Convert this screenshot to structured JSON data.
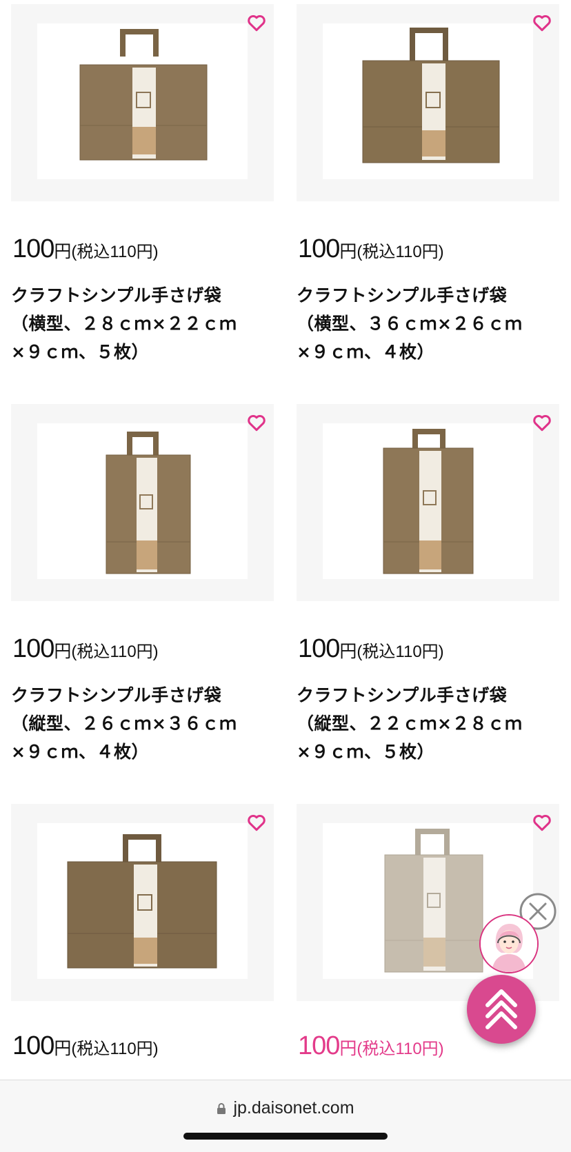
{
  "products": [
    {
      "price": "100",
      "unit": "円",
      "tax": "(税込110円)",
      "title": "クラフトシンプル手さげ袋\n（横型、２８ｃｍ×２２ｃｍ\n×９ｃｍ、５枚）",
      "bag_color": "#8d7657",
      "orientation": "landscape",
      "favorite_icon": "heart-outline-icon"
    },
    {
      "price": "100",
      "unit": "円",
      "tax": "(税込110円)",
      "title": "クラフトシンプル手さげ袋\n（横型、３６ｃｍ×２６ｃｍ\n×９ｃｍ、４枚）",
      "bag_color": "#86704f",
      "orientation": "landscape",
      "favorite_icon": "heart-outline-icon"
    },
    {
      "price": "100",
      "unit": "円",
      "tax": "(税込110円)",
      "title": "クラフトシンプル手さげ袋\n（縦型、２６ｃｍ×３６ｃｍ\n×９ｃｍ、４枚）",
      "bag_color": "#8f7858",
      "orientation": "portrait",
      "favorite_icon": "heart-outline-icon"
    },
    {
      "price": "100",
      "unit": "円",
      "tax": "(税込110円)",
      "title": "クラフトシンプル手さげ袋\n（縦型、２２ｃｍ×２８ｃｍ\n×９ｃｍ、５枚）",
      "bag_color": "#8e7757",
      "orientation": "portrait",
      "favorite_icon": "heart-outline-icon"
    },
    {
      "price": "100",
      "unit": "円",
      "tax": "(税込110円)",
      "title": "",
      "bag_color": "#816b4c",
      "orientation": "landscape",
      "favorite_icon": "heart-outline-icon"
    },
    {
      "price": "100",
      "unit": "円",
      "tax": "(税込110円)",
      "title": "",
      "bag_color": "#c6bdae",
      "orientation": "portrait",
      "favorite_icon": "heart-outline-icon",
      "price_color": "#e33b8a"
    }
  ],
  "browser": {
    "url": "jp.daisonet.com",
    "lock_icon": "lock-icon"
  },
  "floating": {
    "close_icon": "close-circle-icon",
    "support_icon": "support-operator-avatar-icon",
    "top_icon": "scroll-to-top-chevrons-icon"
  },
  "colors": {
    "accent": "#e33b8a",
    "heart": "#e0338a",
    "card_bg": "#f6f6f6"
  }
}
